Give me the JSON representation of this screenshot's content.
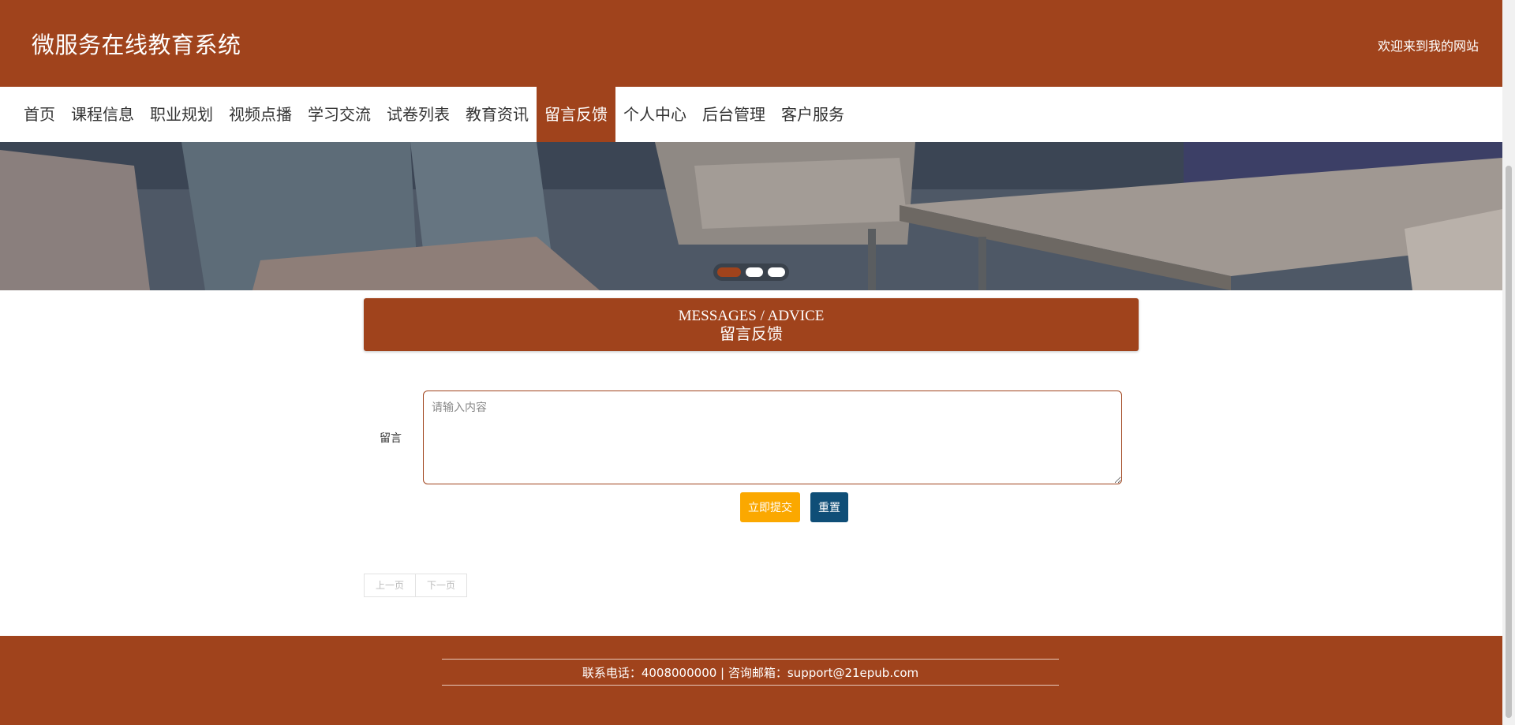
{
  "header": {
    "site_title": "微服务在线教育系统",
    "welcome_text": "欢迎来到我的网站",
    "brand_color": "#a0431c"
  },
  "nav": {
    "items": [
      "首页",
      "课程信息",
      "职业规划",
      "视频点播",
      "学习交流",
      "试卷列表",
      "教育资讯",
      "留言反馈",
      "个人中心",
      "后台管理",
      "客户服务"
    ],
    "active": "留言反馈"
  },
  "banner": {
    "slide_count": 3,
    "active_slide": 1
  },
  "section": {
    "title_en": "MESSAGES / ADVICE",
    "title_cn": "留言反馈"
  },
  "form": {
    "message_label": "留言",
    "message_placeholder": "请输入内容",
    "message_value": "",
    "submit_label": "立即提交",
    "reset_label": "重置",
    "submit_color": "#fba800",
    "reset_color": "#0f4e77"
  },
  "pager": {
    "prev_label": "上一页",
    "next_label": "下一页"
  },
  "footer": {
    "contact_text": "联系电话：4008000000 | 咨询邮箱：support@21epub.com"
  }
}
